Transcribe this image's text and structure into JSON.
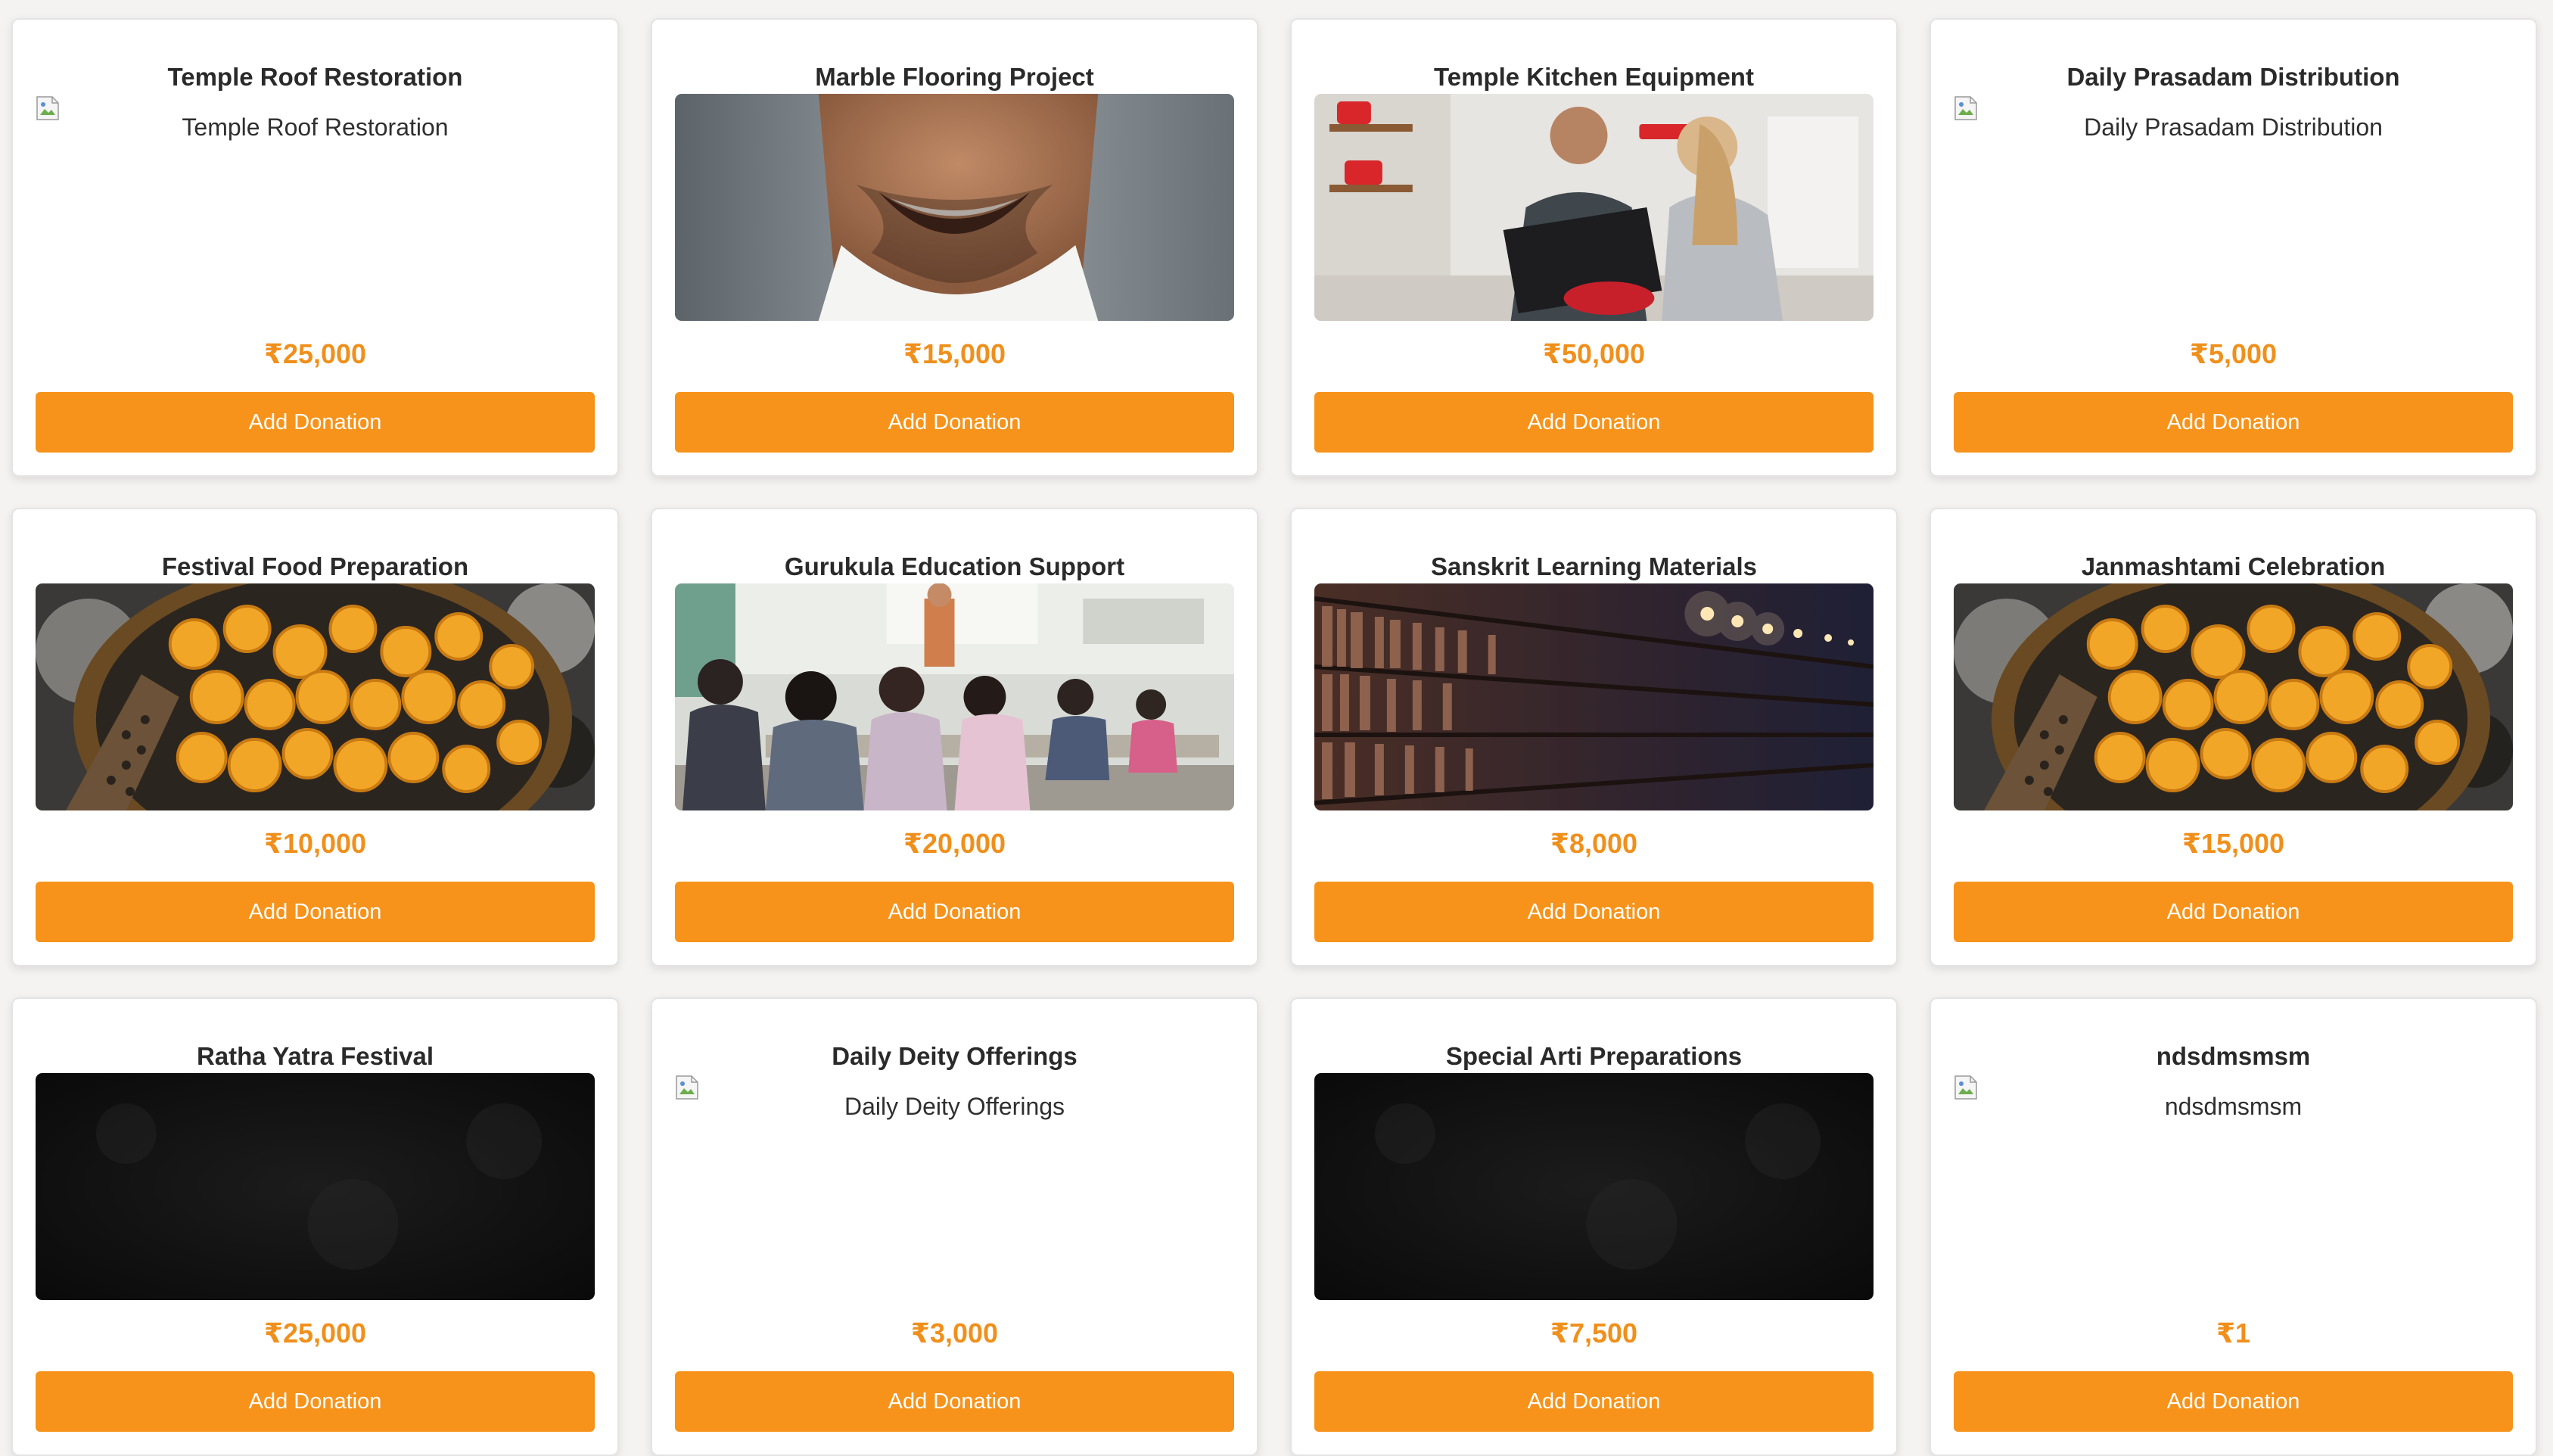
{
  "colors": {
    "accent": "#f7931a",
    "price": "#f0901c",
    "card_bg": "#ffffff",
    "page_bg": "#f4f3f2"
  },
  "cards": [
    {
      "title": "Temple Roof Restoration",
      "price": "₹25,000",
      "button": "Add Donation",
      "image": {
        "kind": "broken",
        "alt": "Temple Roof Restoration"
      }
    },
    {
      "title": "Marble Flooring Project",
      "price": "₹15,000",
      "button": "Add Donation",
      "image": {
        "kind": "smile"
      }
    },
    {
      "title": "Temple Kitchen Equipment",
      "price": "₹50,000",
      "button": "Add Donation",
      "image": {
        "kind": "kitchen"
      }
    },
    {
      "title": "Daily Prasadam Distribution",
      "price": "₹5,000",
      "button": "Add Donation",
      "image": {
        "kind": "broken",
        "alt": "Daily Prasadam Distribution"
      }
    },
    {
      "title": "Festival Food Preparation",
      "price": "₹10,000",
      "button": "Add Donation",
      "image": {
        "kind": "food"
      }
    },
    {
      "title": "Gurukula Education Support",
      "price": "₹20,000",
      "button": "Add Donation",
      "image": {
        "kind": "classroom"
      }
    },
    {
      "title": "Sanskrit Learning Materials",
      "price": "₹8,000",
      "button": "Add Donation",
      "image": {
        "kind": "library"
      }
    },
    {
      "title": "Janmashtami Celebration",
      "price": "₹15,000",
      "button": "Add Donation",
      "image": {
        "kind": "food"
      }
    },
    {
      "title": "Ratha Yatra Festival",
      "price": "₹25,000",
      "button": "Add Donation",
      "image": {
        "kind": "dark"
      }
    },
    {
      "title": "Daily Deity Offerings",
      "price": "₹3,000",
      "button": "Add Donation",
      "image": {
        "kind": "broken",
        "alt": "Daily Deity Offerings"
      }
    },
    {
      "title": "Special Arti Preparations",
      "price": "₹7,500",
      "button": "Add Donation",
      "image": {
        "kind": "dark"
      }
    },
    {
      "title": "ndsdmsmsm",
      "price": "₹1",
      "button": "Add Donation",
      "image": {
        "kind": "broken",
        "alt": "ndsdmsmsm"
      }
    }
  ]
}
